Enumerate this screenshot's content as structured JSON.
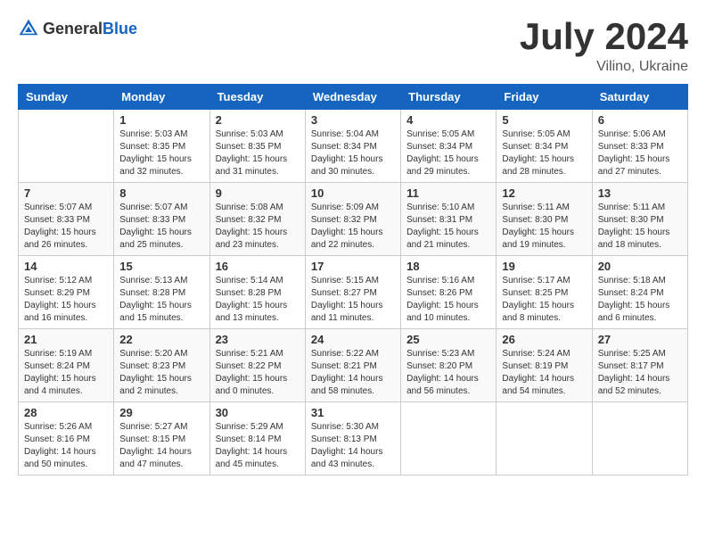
{
  "header": {
    "logo_general": "General",
    "logo_blue": "Blue",
    "month_title": "July 2024",
    "subtitle": "Vilino, Ukraine"
  },
  "days_of_week": [
    "Sunday",
    "Monday",
    "Tuesday",
    "Wednesday",
    "Thursday",
    "Friday",
    "Saturday"
  ],
  "weeks": [
    [
      {
        "day": "",
        "info": ""
      },
      {
        "day": "1",
        "info": "Sunrise: 5:03 AM\nSunset: 8:35 PM\nDaylight: 15 hours\nand 32 minutes."
      },
      {
        "day": "2",
        "info": "Sunrise: 5:03 AM\nSunset: 8:35 PM\nDaylight: 15 hours\nand 31 minutes."
      },
      {
        "day": "3",
        "info": "Sunrise: 5:04 AM\nSunset: 8:34 PM\nDaylight: 15 hours\nand 30 minutes."
      },
      {
        "day": "4",
        "info": "Sunrise: 5:05 AM\nSunset: 8:34 PM\nDaylight: 15 hours\nand 29 minutes."
      },
      {
        "day": "5",
        "info": "Sunrise: 5:05 AM\nSunset: 8:34 PM\nDaylight: 15 hours\nand 28 minutes."
      },
      {
        "day": "6",
        "info": "Sunrise: 5:06 AM\nSunset: 8:33 PM\nDaylight: 15 hours\nand 27 minutes."
      }
    ],
    [
      {
        "day": "7",
        "info": "Sunrise: 5:07 AM\nSunset: 8:33 PM\nDaylight: 15 hours\nand 26 minutes."
      },
      {
        "day": "8",
        "info": "Sunrise: 5:07 AM\nSunset: 8:33 PM\nDaylight: 15 hours\nand 25 minutes."
      },
      {
        "day": "9",
        "info": "Sunrise: 5:08 AM\nSunset: 8:32 PM\nDaylight: 15 hours\nand 23 minutes."
      },
      {
        "day": "10",
        "info": "Sunrise: 5:09 AM\nSunset: 8:32 PM\nDaylight: 15 hours\nand 22 minutes."
      },
      {
        "day": "11",
        "info": "Sunrise: 5:10 AM\nSunset: 8:31 PM\nDaylight: 15 hours\nand 21 minutes."
      },
      {
        "day": "12",
        "info": "Sunrise: 5:11 AM\nSunset: 8:30 PM\nDaylight: 15 hours\nand 19 minutes."
      },
      {
        "day": "13",
        "info": "Sunrise: 5:11 AM\nSunset: 8:30 PM\nDaylight: 15 hours\nand 18 minutes."
      }
    ],
    [
      {
        "day": "14",
        "info": "Sunrise: 5:12 AM\nSunset: 8:29 PM\nDaylight: 15 hours\nand 16 minutes."
      },
      {
        "day": "15",
        "info": "Sunrise: 5:13 AM\nSunset: 8:28 PM\nDaylight: 15 hours\nand 15 minutes."
      },
      {
        "day": "16",
        "info": "Sunrise: 5:14 AM\nSunset: 8:28 PM\nDaylight: 15 hours\nand 13 minutes."
      },
      {
        "day": "17",
        "info": "Sunrise: 5:15 AM\nSunset: 8:27 PM\nDaylight: 15 hours\nand 11 minutes."
      },
      {
        "day": "18",
        "info": "Sunrise: 5:16 AM\nSunset: 8:26 PM\nDaylight: 15 hours\nand 10 minutes."
      },
      {
        "day": "19",
        "info": "Sunrise: 5:17 AM\nSunset: 8:25 PM\nDaylight: 15 hours\nand 8 minutes."
      },
      {
        "day": "20",
        "info": "Sunrise: 5:18 AM\nSunset: 8:24 PM\nDaylight: 15 hours\nand 6 minutes."
      }
    ],
    [
      {
        "day": "21",
        "info": "Sunrise: 5:19 AM\nSunset: 8:24 PM\nDaylight: 15 hours\nand 4 minutes."
      },
      {
        "day": "22",
        "info": "Sunrise: 5:20 AM\nSunset: 8:23 PM\nDaylight: 15 hours\nand 2 minutes."
      },
      {
        "day": "23",
        "info": "Sunrise: 5:21 AM\nSunset: 8:22 PM\nDaylight: 15 hours\nand 0 minutes."
      },
      {
        "day": "24",
        "info": "Sunrise: 5:22 AM\nSunset: 8:21 PM\nDaylight: 14 hours\nand 58 minutes."
      },
      {
        "day": "25",
        "info": "Sunrise: 5:23 AM\nSunset: 8:20 PM\nDaylight: 14 hours\nand 56 minutes."
      },
      {
        "day": "26",
        "info": "Sunrise: 5:24 AM\nSunset: 8:19 PM\nDaylight: 14 hours\nand 54 minutes."
      },
      {
        "day": "27",
        "info": "Sunrise: 5:25 AM\nSunset: 8:17 PM\nDaylight: 14 hours\nand 52 minutes."
      }
    ],
    [
      {
        "day": "28",
        "info": "Sunrise: 5:26 AM\nSunset: 8:16 PM\nDaylight: 14 hours\nand 50 minutes."
      },
      {
        "day": "29",
        "info": "Sunrise: 5:27 AM\nSunset: 8:15 PM\nDaylight: 14 hours\nand 47 minutes."
      },
      {
        "day": "30",
        "info": "Sunrise: 5:29 AM\nSunset: 8:14 PM\nDaylight: 14 hours\nand 45 minutes."
      },
      {
        "day": "31",
        "info": "Sunrise: 5:30 AM\nSunset: 8:13 PM\nDaylight: 14 hours\nand 43 minutes."
      },
      {
        "day": "",
        "info": ""
      },
      {
        "day": "",
        "info": ""
      },
      {
        "day": "",
        "info": ""
      }
    ]
  ]
}
